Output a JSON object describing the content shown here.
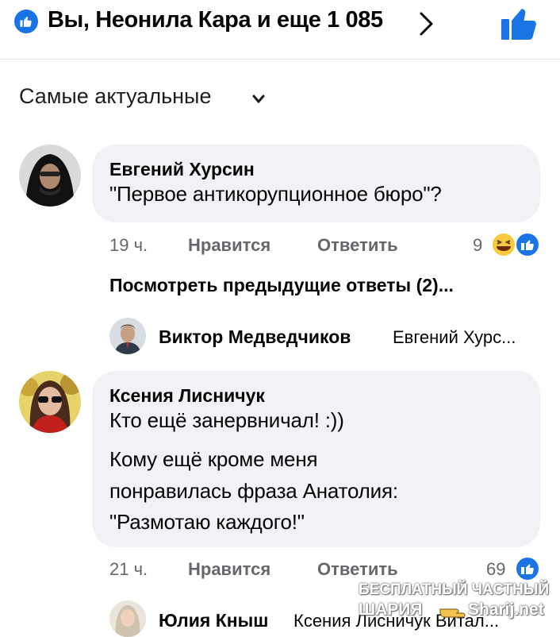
{
  "header": {
    "reactions_text": "Вы, Неонила Кара и еще 1 085",
    "like_icon": "thumbs-up-icon",
    "chevron_icon": "chevron-right-icon",
    "accent_color": "#1b74e4"
  },
  "sort": {
    "label": "Самые актуальные",
    "icon": "chevron-down-icon"
  },
  "comments": [
    {
      "author": "Евгений Хурсин",
      "text": "\"Первое антикорупционное бюро\"?",
      "time": "19 ч.",
      "like_label": "Нравится",
      "reply_label": "Ответить",
      "reaction_count": "9",
      "reactions": [
        "laugh-icon",
        "like-icon"
      ],
      "view_replies": "Посмотреть предыдущие ответы (2)...",
      "reply": {
        "author": "Виктор Медведчиков",
        "preview": "Евгений Хурс..."
      }
    },
    {
      "author": "Ксения Лисничук",
      "lines": [
        "Кто ещё занервничал! :))",
        "Кому ещё кроме меня",
        "понравилась фраза Анатолия:",
        "\"Размотаю каждого!\""
      ],
      "time": "21 ч.",
      "like_label": "Нравится",
      "reply_label": "Ответить",
      "reaction_count": "69",
      "reactions": [
        "like-icon"
      ],
      "reply": {
        "author": "Юлия Кныш",
        "preview": "Ксения Лисничук Витал..."
      }
    }
  ],
  "watermark": {
    "line1": "БЕСПЛАТНЫЙ ЧАСТНЫЙ",
    "line2": "ШАРИЯ",
    "line3": "Sharij.net"
  }
}
